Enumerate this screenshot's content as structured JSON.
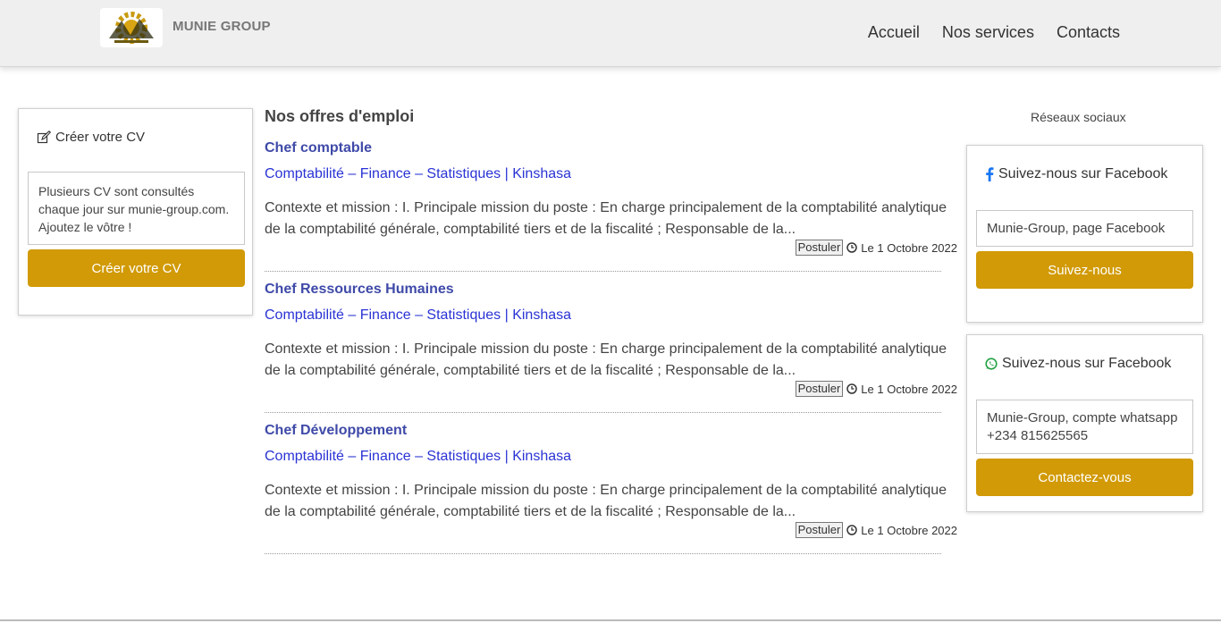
{
  "header": {
    "brand": "MUNIE GROUP",
    "nav": [
      "Accueil",
      "Nos services",
      "Contacts"
    ]
  },
  "cv": {
    "icon": "edit-icon",
    "title": "Créer votre CV",
    "text": "Plusieurs CV sont consultés chaque jour sur munie-group.com. Ajoutez le vôtre !",
    "button": "Créer votre CV"
  },
  "jobs": {
    "title": "Nos offres d'emploi",
    "items": [
      {
        "title": "Chef comptable",
        "category": "Comptabilité – Finance – Statistiques | Kinshasa",
        "description": "Contexte et mission : I. Principale mission du poste : En charge principalement de la comptabilité analytique de la comptabilité générale, comptabilité tiers et de la fiscalité ; Responsable de la...",
        "apply": "Postuler",
        "date": "Le 1 Octobre 2022"
      },
      {
        "title": "Chef Ressources Humaines",
        "category": "Comptabilité – Finance – Statistiques | Kinshasa",
        "description": "Contexte et mission : I. Principale mission du poste : En charge principalement de la comptabilité analytique de la comptabilité générale, comptabilité tiers et de la fiscalité ; Responsable de la...",
        "apply": "Postuler",
        "date": "Le 1 Octobre 2022"
      },
      {
        "title": "Chef Développement",
        "category": "Comptabilité – Finance – Statistiques | Kinshasa",
        "description": "Contexte et mission : I. Principale mission du poste : En charge principalement de la comptabilité analytique de la comptabilité générale, comptabilité tiers et de la fiscalité ; Responsable de la...",
        "apply": "Postuler",
        "date": "Le 1 Octobre 2022"
      }
    ]
  },
  "social": {
    "title": "Réseaux sociaux",
    "facebook": {
      "icon": "facebook-icon",
      "title": "Suivez-nous sur Facebook",
      "field": "Munie-Group, page Facebook",
      "button": "Suivez-nous"
    },
    "whatsapp": {
      "icon": "whatsapp-icon",
      "title": "Suivez-nous sur Facebook",
      "field": "Munie-Group, compte whatsapp +234 815625565",
      "button": "Contactez-vous"
    }
  },
  "colors": {
    "accent": "#d19a06",
    "link": "#2a33d4",
    "job_title": "#3f4aa8",
    "facebook": "#1877f2",
    "whatsapp": "#25a244"
  }
}
